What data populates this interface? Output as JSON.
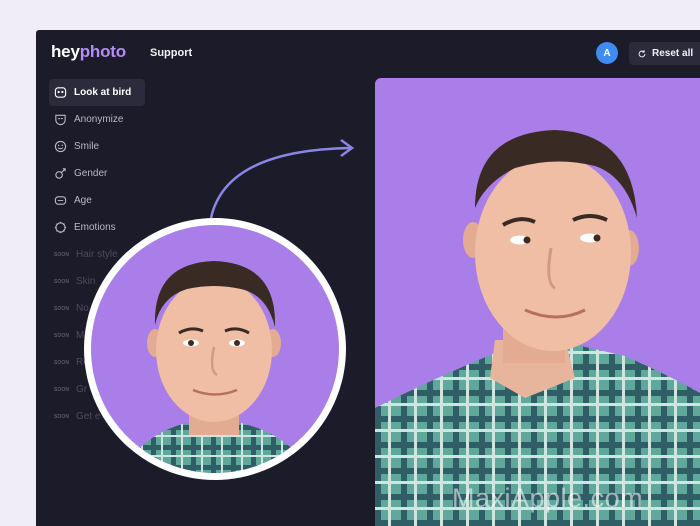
{
  "header": {
    "logo_part1": "hey",
    "logo_part2": "photo",
    "support_label": "Support",
    "avatar_initial": "A",
    "reset_label": "Reset all"
  },
  "sidebar": {
    "items": [
      {
        "label": "Look at bird",
        "icon": "bird-eye-icon",
        "active": true
      },
      {
        "label": "Anonymize",
        "icon": "mask-icon"
      },
      {
        "label": "Smile",
        "icon": "smile-icon"
      },
      {
        "label": "Gender",
        "icon": "gender-icon"
      },
      {
        "label": "Age",
        "icon": "age-icon"
      },
      {
        "label": "Emotions",
        "icon": "emotions-icon"
      }
    ],
    "soon_badge": "SOON",
    "soon_items": [
      "Hair style",
      "Skin",
      "No",
      "M",
      "Re",
      "Gr",
      "Get e"
    ]
  },
  "watermark": "MaxiApple.com",
  "colors": {
    "background": "#1c1b29",
    "accent": "#b48cf5",
    "photo_bg": "#aa7ee8",
    "avatar": "#3f8bf2"
  }
}
